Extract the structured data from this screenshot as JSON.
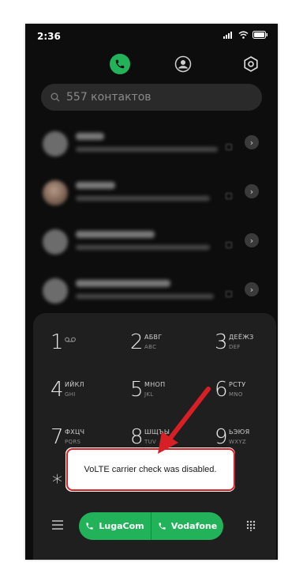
{
  "status_bar": {
    "time": "2:36"
  },
  "search": {
    "placeholder": "557 контактов"
  },
  "dialpad": {
    "keys": [
      {
        "digit": "1",
        "letters": "",
        "latin": ""
      },
      {
        "digit": "2",
        "letters": "АБВГ",
        "latin": "ABC"
      },
      {
        "digit": "3",
        "letters": "ДЕЁЖЗ",
        "latin": "DEF"
      },
      {
        "digit": "4",
        "letters": "ИЙКЛ",
        "latin": "GHI"
      },
      {
        "digit": "5",
        "letters": "МНОП",
        "latin": "JKL"
      },
      {
        "digit": "6",
        "letters": "РСТУ",
        "latin": "MNO"
      },
      {
        "digit": "7",
        "letters": "ФХЦЧ",
        "latin": "PQRS"
      },
      {
        "digit": "8",
        "letters": "ШЩЪЫ",
        "latin": "TUV"
      },
      {
        "digit": "9",
        "letters": "ЬЭЮЯ",
        "latin": "WXYZ"
      },
      {
        "digit": "*",
        "letters": "",
        "latin": ""
      }
    ]
  },
  "call_buttons": {
    "sim1": "LugaCom",
    "sim2": "Vodafone"
  },
  "toast": {
    "message": "VoLTE carrier check was disabled."
  },
  "colors": {
    "accent": "#22b35a",
    "highlight": "#d81f26",
    "background": "#0d0d0d",
    "panel": "#1f1f1f"
  },
  "icons": [
    "wifi-icon",
    "battery-icon",
    "signal-icon",
    "phone-tab-icon",
    "contacts-tab-icon",
    "settings-gear-icon",
    "search-icon",
    "chevron-right-icon",
    "voicemail-icon",
    "menu-icon",
    "keypad-icon",
    "phone-call-icon"
  ]
}
